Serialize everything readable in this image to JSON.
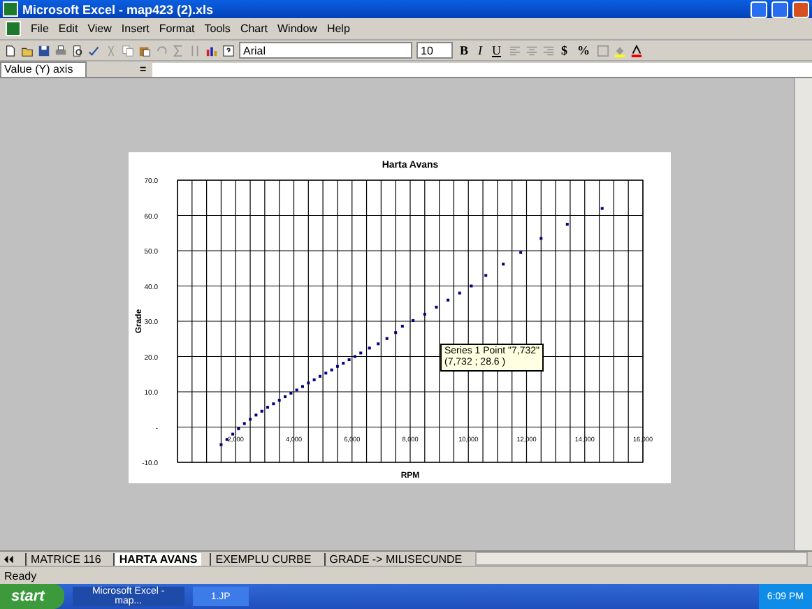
{
  "window": {
    "title": "Microsoft Excel - map423 (2).xls"
  },
  "menu": [
    "File",
    "Edit",
    "View",
    "Insert",
    "Format",
    "Tools",
    "Chart",
    "Window",
    "Help"
  ],
  "toolbar": {
    "font": "Arial",
    "size": "10",
    "format_buttons": [
      "B",
      "I",
      "U"
    ],
    "number_buttons": [
      "$",
      "%"
    ]
  },
  "formula_bar": {
    "name_box": "Value (Y) axis",
    "equals": "="
  },
  "chart": {
    "chart_data": {
      "type": "scatter",
      "grid": true,
      "title": "Harta Avans",
      "xlabel": "RPM",
      "ylabel": "Grade",
      "xlim": [
        0,
        16000
      ],
      "ylim": [
        -10,
        70
      ],
      "xticks": [
        {
          "value": 2000,
          "label": "2,000"
        },
        {
          "value": 4000,
          "label": "4,000"
        },
        {
          "value": 6000,
          "label": "6,000"
        },
        {
          "value": 8000,
          "label": "8,000"
        },
        {
          "value": 10000,
          "label": "10,000"
        },
        {
          "value": 12000,
          "label": "12,000"
        },
        {
          "value": 14000,
          "label": "14,000"
        },
        {
          "value": 16000,
          "label": "16,000"
        }
      ],
      "yticks": [
        {
          "value": -10,
          "label": "-10.0"
        },
        {
          "value": 0,
          "label": "-"
        },
        {
          "value": 10,
          "label": "10.0"
        },
        {
          "value": 20,
          "label": "20.0"
        },
        {
          "value": 30,
          "label": "30.0"
        },
        {
          "value": 40,
          "label": "40.0"
        },
        {
          "value": 50,
          "label": "50.0"
        },
        {
          "value": 60,
          "label": "60.0"
        },
        {
          "value": 70,
          "label": "70.0"
        }
      ],
      "x": [
        1500,
        1700,
        1900,
        2100,
        2300,
        2500,
        2700,
        2900,
        3100,
        3300,
        3500,
        3700,
        3900,
        4100,
        4300,
        4500,
        4700,
        4900,
        5100,
        5300,
        5500,
        5700,
        5900,
        6100,
        6300,
        6600,
        6900,
        7200,
        7500,
        7732,
        8100,
        8500,
        8900,
        9300,
        9700,
        10100,
        10600,
        11200,
        11800,
        12500,
        13400,
        14600
      ],
      "series": [
        {
          "color": "#000080",
          "values": [
            -5,
            -3.5,
            -2,
            -0.5,
            1,
            2.2,
            3.4,
            4.5,
            5.6,
            6.6,
            7.6,
            8.6,
            9.6,
            10.5,
            11.5,
            12.5,
            13.4,
            14.4,
            15.3,
            16.2,
            17.2,
            18.1,
            19.1,
            20,
            21,
            22.4,
            23.6,
            25.1,
            26.8,
            28.6,
            30.2,
            32,
            34,
            36,
            38,
            40,
            43,
            46.2,
            49.5,
            53.5,
            57.5,
            62
          ]
        }
      ]
    },
    "tooltip": [
      "Series 1 Point \"7,732\"",
      "(7,732 ; 28.6 )"
    ]
  },
  "sheet_tabs": [
    {
      "label": "MATRICE 116",
      "selected": false
    },
    {
      "label": "HARTA AVANS",
      "selected": true
    },
    {
      "label": "EXEMPLU CURBE",
      "selected": false
    },
    {
      "label": "GRADE -> MILISECUNDE",
      "selected": false
    }
  ],
  "status_bar": "Ready",
  "taskbar": {
    "start": "start",
    "items": [
      {
        "label": "Microsoft Excel - map...",
        "selected": true
      },
      {
        "label": "1.JP",
        "selected": false
      }
    ],
    "clock": "6:09 PM"
  }
}
